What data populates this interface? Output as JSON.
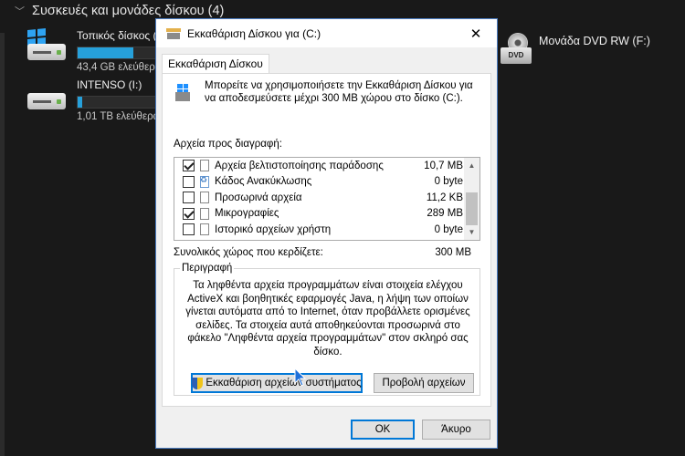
{
  "explorer": {
    "section_title": "Συσκευές και μονάδες δίσκου (4)",
    "drives": [
      {
        "name": "Τοπικός δίσκος (",
        "free": "43,4 GB ελεύθερα",
        "fill": 0.52
      },
      {
        "name": "INTENSO (I:)",
        "free": "1,01 TB ελεύθερα",
        "fill": 0.04
      }
    ],
    "dvd": {
      "name": "Μονάδα DVD RW (F:)",
      "badge": "DVD"
    }
  },
  "dialog": {
    "title": "Εκκαθάριση Δίσκου για  (C:)",
    "close": "✕",
    "tab": "Εκκαθάριση Δίσκου",
    "intro": "Μπορείτε να χρησιμοποιήσετε την Εκκαθάριση Δίσκου για να αποδεσμεύσετε μέχρι 300 MB χώρου στο δίσκο  (C:).",
    "files_label": "Αρχεία προς διαγραφή:",
    "files": [
      {
        "name": "Αρχεία βελτιστοποίησης παράδοσης",
        "size": "10,7 MB",
        "checked": true,
        "icon": "file-icon"
      },
      {
        "name": "Κάδος Ανακύκλωσης",
        "size": "0 byte",
        "checked": false,
        "icon": "recycle-bin-icon"
      },
      {
        "name": "Προσωρινά αρχεία",
        "size": "11,2 KB",
        "checked": false,
        "icon": "file-icon"
      },
      {
        "name": "Μικρογραφίες",
        "size": "289 MB",
        "checked": true,
        "icon": "file-icon"
      },
      {
        "name": "Ιστορικό αρχείων χρήστη",
        "size": "0 byte",
        "checked": false,
        "icon": "file-icon"
      }
    ],
    "total_label": "Συνολικός χώρος που κερδίζετε:",
    "total_value": "300 MB",
    "description_legend": "Περιγραφή",
    "description": "Τα ληφθέντα αρχεία προγραμμάτων είναι στοιχεία ελέγχου ActiveX και βοηθητικές εφαρμογές Java, η λήψη των οποίων γίνεται αυτόματα από το Internet, όταν προβάλλετε ορισμένες σελίδες. Τα στοιχεία αυτά αποθηκεύονται προσωρινά στο φάκελο \"Ληφθέντα αρχεία προγραμμάτων\" στον σκληρό σας δίσκο.",
    "cleanup_system_button": "Εκκαθάριση αρχείων συστήματος",
    "view_files_button": "Προβολή αρχείων",
    "ok_button": "OK",
    "cancel_button": "Άκυρο"
  },
  "colors": {
    "accent": "#0078d7",
    "drive_bar": "#26a0da",
    "background": "#191919"
  }
}
